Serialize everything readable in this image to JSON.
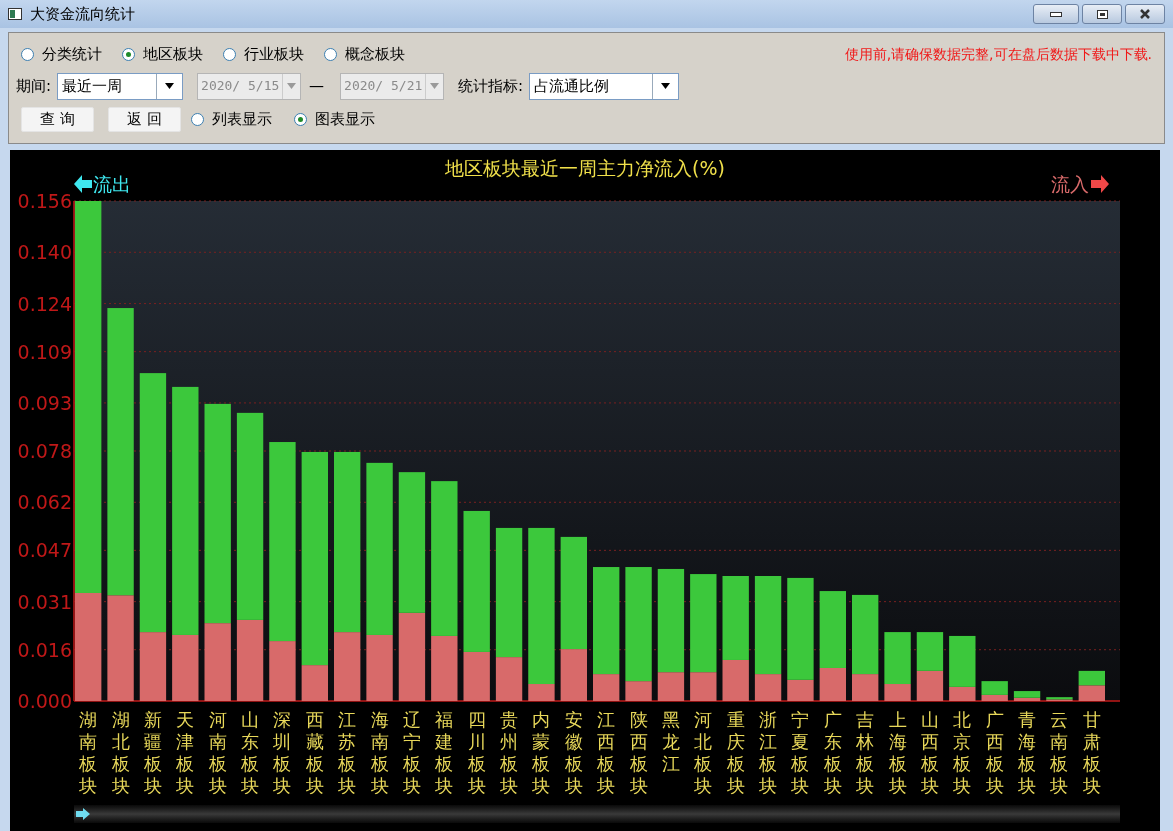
{
  "window": {
    "title": "大资金流向统计"
  },
  "notice": "使用前,请确保数据完整,可在盘后数据下载中下载.",
  "modes": [
    {
      "label": "分类统计",
      "selected": false
    },
    {
      "label": "地区板块",
      "selected": true
    },
    {
      "label": "行业板块",
      "selected": false
    },
    {
      "label": "概念板块",
      "selected": false
    }
  ],
  "period": {
    "label": "期间:",
    "value": "最近一周"
  },
  "date_from": {
    "value": "2020/ 5/15",
    "disabled": true
  },
  "date_separator": "—",
  "date_to": {
    "value": "2020/ 5/21",
    "disabled": true
  },
  "metric": {
    "label": "统计指标:",
    "value": "占流通比例"
  },
  "buttons": [
    "查 询",
    "返 回"
  ],
  "views": [
    {
      "label": "列表显示",
      "selected": false
    },
    {
      "label": "图表显示",
      "selected": true
    }
  ],
  "chart": {
    "chart_data": {
      "type": "bar",
      "title": "地区板块最近一周主力净流入(%)",
      "stacked": true,
      "grid": true,
      "categories": [
        "湖南板块",
        "湖北板块",
        "新疆板块",
        "天津板块",
        "河南板块",
        "山东板块",
        "深圳板块",
        "西藏板块",
        "江苏板块",
        "海南板块",
        "辽宁板块",
        "福建板块",
        "四川板块",
        "贵州板块",
        "内蒙板块",
        "安徽板块",
        "江西板块",
        "陕西板块",
        "黑龙江",
        "河北板块",
        "重庆板块",
        "浙江板块",
        "宁夏板块",
        "广东板块",
        "吉林板块",
        "上海板块",
        "山西板块",
        "北京板块",
        "广西板块",
        "青海板块",
        "云南板块",
        "甘肃板块"
      ],
      "series": [
        {
          "name": "流入",
          "color": "#d86a6a",
          "values": [
            0.0337,
            0.033,
            0.0215,
            0.0206,
            0.0243,
            0.0253,
            0.0187,
            0.0112,
            0.0215,
            0.0206,
            0.0275,
            0.0203,
            0.0153,
            0.0137,
            0.0053,
            0.0162,
            0.0084,
            0.0062,
            0.009,
            0.009,
            0.0128,
            0.0084,
            0.0066,
            0.0103,
            0.0084,
            0.0053,
            0.0094,
            0.0044,
            0.0019,
            0.001,
            0.0005,
            0.0049
          ]
        },
        {
          "name": "流出",
          "color": "#3cc83c",
          "values": [
            0.1223,
            0.0896,
            0.0808,
            0.0774,
            0.0684,
            0.0646,
            0.0621,
            0.0665,
            0.0562,
            0.0537,
            0.0439,
            0.0483,
            0.044,
            0.0403,
            0.0487,
            0.035,
            0.0334,
            0.0356,
            0.0322,
            0.0306,
            0.0262,
            0.0306,
            0.0318,
            0.024,
            0.0247,
            0.0162,
            0.0121,
            0.0159,
            0.0043,
            0.0021,
            0.0007,
            0.0045
          ]
        }
      ],
      "ylim": [
        0,
        0.156
      ],
      "yticks": [
        {
          "value": 0,
          "label": "0.000"
        },
        {
          "value": 0.016,
          "label": "0.016"
        },
        {
          "value": 0.031,
          "label": "0.031"
        },
        {
          "value": 0.047,
          "label": "0.047"
        },
        {
          "value": 0.062,
          "label": "0.062"
        },
        {
          "value": 0.078,
          "label": "0.078"
        },
        {
          "value": 0.093,
          "label": "0.093"
        },
        {
          "value": 0.109,
          "label": "0.109"
        },
        {
          "value": 0.124,
          "label": "0.124"
        },
        {
          "value": 0.14,
          "label": "0.140"
        },
        {
          "value": 0.156,
          "label": "0.156"
        }
      ]
    }
  }
}
